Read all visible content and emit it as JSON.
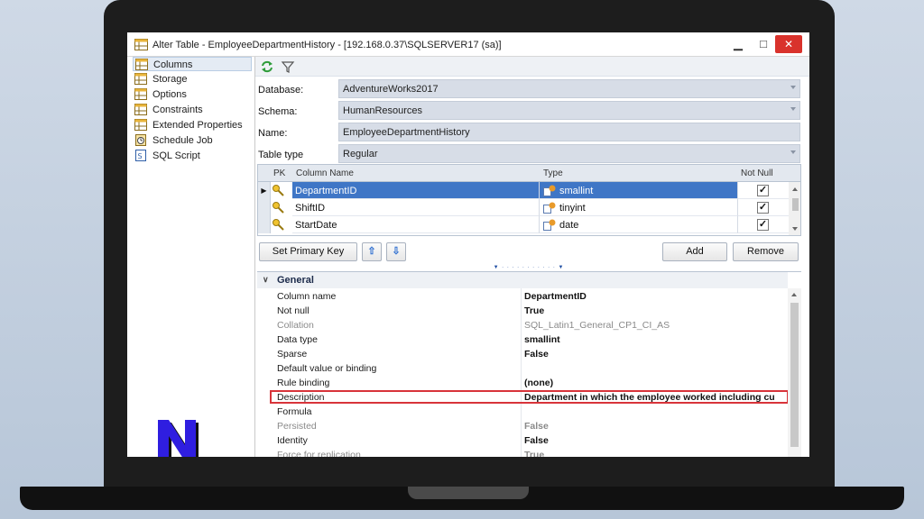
{
  "window": {
    "title": "Alter Table - EmployeeDepartmentHistory - [192.168.0.37\\SQLSERVER17 (sa)]",
    "minimize": "▁",
    "maximize": "□",
    "close": "✕"
  },
  "sidebar": {
    "items": [
      {
        "label": "Columns",
        "icon": "table-icon"
      },
      {
        "label": "Storage",
        "icon": "table-icon"
      },
      {
        "label": "Options",
        "icon": "table-icon"
      },
      {
        "label": "Constraints",
        "icon": "table-icon"
      },
      {
        "label": "Extended Properties",
        "icon": "table-icon"
      },
      {
        "label": "Schedule Job",
        "icon": "schedule-icon"
      },
      {
        "label": "SQL Script",
        "icon": "script-icon"
      }
    ],
    "selected_index": 0
  },
  "form": {
    "database_label": "Database:",
    "database_value": "AdventureWorks2017",
    "schema_label": "Schema:",
    "schema_value": "HumanResources",
    "name_label": "Name:",
    "name_value": "EmployeeDepartmentHistory",
    "table_type_label": "Table type",
    "table_type_value": "Regular"
  },
  "grid": {
    "headers": {
      "pk": "PK",
      "name": "Column Name",
      "type": "Type",
      "not_null": "Not Null"
    },
    "rows": [
      {
        "name": "DepartmentID",
        "type": "smallint",
        "not_null": true,
        "pk": true,
        "selected": true
      },
      {
        "name": "ShiftID",
        "type": "tinyint",
        "not_null": true,
        "pk": true,
        "selected": false
      },
      {
        "name": "StartDate",
        "type": "date",
        "not_null": true,
        "pk": true,
        "selected": false
      }
    ]
  },
  "buttons": {
    "set_primary_key": "Set Primary Key",
    "move_up": "⇧",
    "move_down": "⇩",
    "add": "Add",
    "remove": "Remove"
  },
  "properties": {
    "category": "General",
    "rows": [
      {
        "name": "Column name",
        "value": "DepartmentID"
      },
      {
        "name": "Not null",
        "value": "True"
      },
      {
        "name": "Collation",
        "value": "SQL_Latin1_General_CP1_CI_AS"
      },
      {
        "name": "Data type",
        "value": "smallint"
      },
      {
        "name": "Sparse",
        "value": "False"
      },
      {
        "name": "Default value or binding",
        "value": ""
      },
      {
        "name": "Rule binding",
        "value": "(none)"
      },
      {
        "name": "Description",
        "value": "Department in which the employee worked including cu"
      },
      {
        "name": "Formula",
        "value": ""
      },
      {
        "name": "Persisted",
        "value": "False"
      },
      {
        "name": "Identity",
        "value": "False"
      },
      {
        "name": "Force for replication",
        "value": "True"
      }
    ]
  },
  "colors": {
    "selection": "#3f76c6",
    "highlight_border": "#d8343a",
    "close_button": "#d9322c",
    "field_bg": "#d7dde7"
  }
}
